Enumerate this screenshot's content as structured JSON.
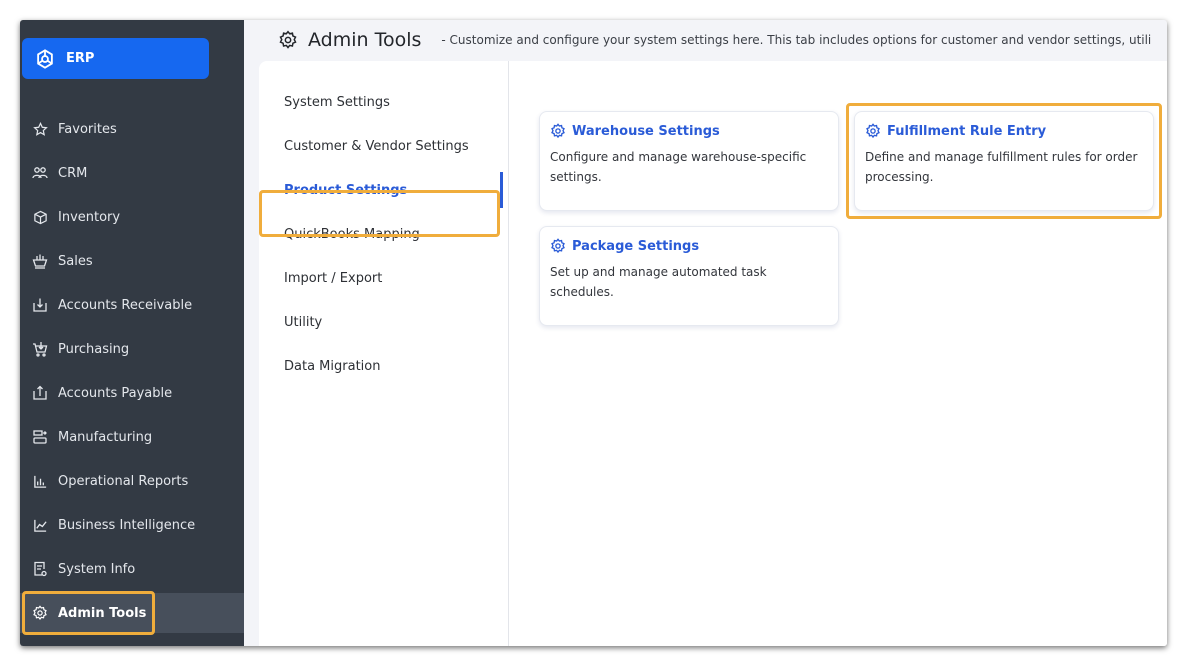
{
  "brand": {
    "label": "ERP",
    "icon": "hub-logo-icon"
  },
  "sidebar": {
    "items": [
      {
        "label": "Favorites",
        "icon": "star-icon",
        "active": false
      },
      {
        "label": "CRM",
        "icon": "people-icon",
        "active": false
      },
      {
        "label": "Inventory",
        "icon": "box-icon",
        "active": false
      },
      {
        "label": "Sales",
        "icon": "sales-icon",
        "active": false
      },
      {
        "label": "Accounts Receivable",
        "icon": "receive-icon",
        "active": false
      },
      {
        "label": "Purchasing",
        "icon": "cart-icon",
        "active": false
      },
      {
        "label": "Accounts Payable",
        "icon": "pay-icon",
        "active": false
      },
      {
        "label": "Manufacturing",
        "icon": "factory-icon",
        "active": false
      },
      {
        "label": "Operational Reports",
        "icon": "bar-chart-icon",
        "active": false
      },
      {
        "label": "Business Intelligence",
        "icon": "line-chart-icon",
        "active": false
      },
      {
        "label": "System Info",
        "icon": "document-gear-icon",
        "active": false
      },
      {
        "label": "Admin Tools",
        "icon": "gear-icon",
        "active": true
      }
    ]
  },
  "header": {
    "title": "Admin Tools",
    "description": "- Customize and configure your system settings here. This tab includes options for customer and vendor settings, utili"
  },
  "settings_nav": {
    "items": [
      {
        "label": "System Settings",
        "active": false
      },
      {
        "label": "Customer & Vendor Settings",
        "active": false
      },
      {
        "label": "Product Settings",
        "active": true
      },
      {
        "label": "QuickBooks Mapping",
        "active": false
      },
      {
        "label": "Import / Export",
        "active": false
      },
      {
        "label": "Utility",
        "active": false
      },
      {
        "label": "Data Migration",
        "active": false
      }
    ]
  },
  "cards": [
    {
      "title": "Warehouse Settings",
      "description": "Configure and manage warehouse-specific settings."
    },
    {
      "title": "Fulfillment Rule Entry",
      "description": "Define and manage fulfillment rules for order processing."
    },
    {
      "title": "Package Settings",
      "description": "Set up and manage automated task schedules."
    }
  ],
  "colors": {
    "sidebar_bg": "#333a44",
    "brand_blue": "#1668f0",
    "accent_blue": "#2a5bd7",
    "highlight_orange": "#f0ad3c"
  }
}
